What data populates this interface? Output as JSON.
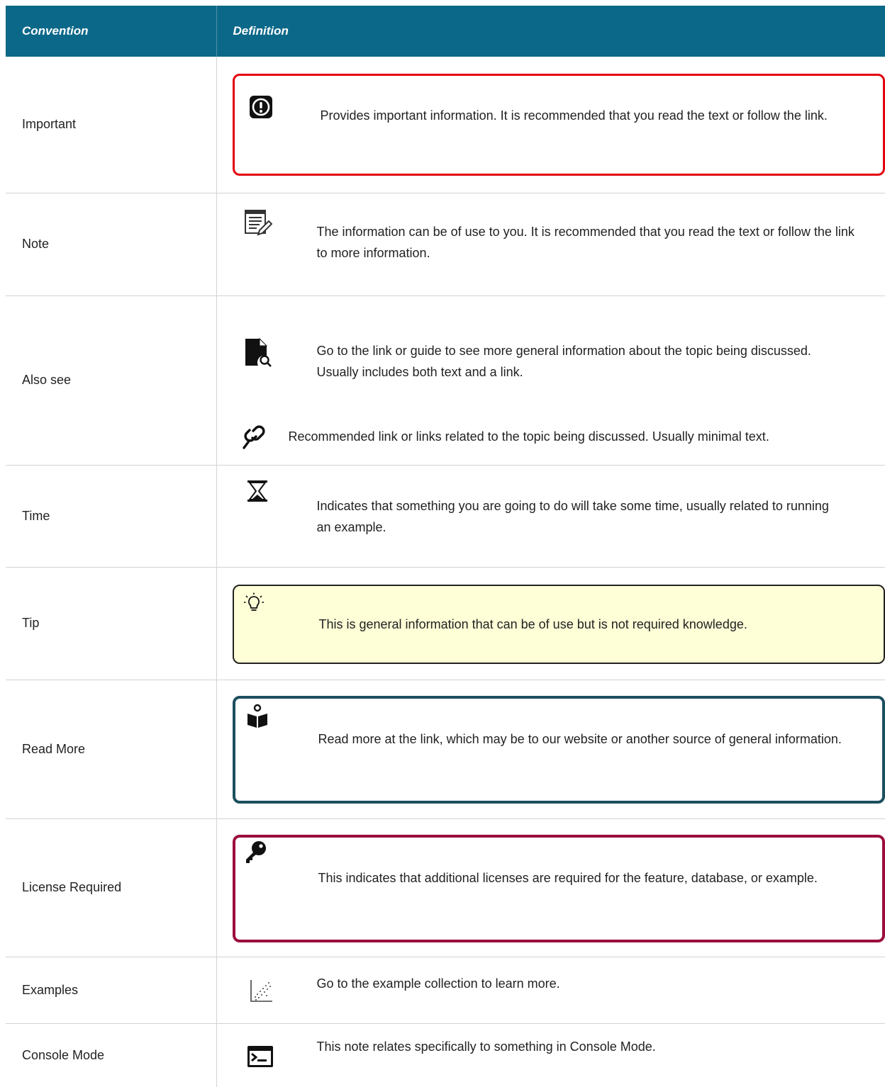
{
  "header": {
    "col1": "Convention",
    "col2": "Definition"
  },
  "rows": [
    {
      "label": "Important",
      "icon": "alert-circle-icon",
      "style": "red-outlined-box",
      "text": "Provides important information. It is recommended that you read the text or follow the link."
    },
    {
      "label": "Note",
      "icon": "note-pencil-icon",
      "text": "The information can be of use to you. It is recommended that you read the text or follow the link to more information."
    },
    {
      "label": "Also see",
      "icon": "document-search-icon",
      "text": "Go to the link or guide to see more general information about the topic being discussed. Usually includes both text and a link.",
      "icon2": "chain-link-icon",
      "text2": "Recommended link or links related to the topic being discussed. Usually minimal text."
    },
    {
      "label": "Time",
      "icon": "hourglass-icon",
      "text": "Indicates that something you are going to do will take some time, usually related to running an example."
    },
    {
      "label": "Tip",
      "icon": "lightbulb-icon",
      "style": "yellow-box",
      "text": "This is general information that can be of use but is not required knowledge."
    },
    {
      "label": "Read More",
      "icon": "book-reader-icon",
      "style": "dark-teal-outlined-box",
      "text": "Read more at the link, which may be to our website or another source of general information."
    },
    {
      "label": "License Required",
      "icon": "key-icon",
      "style": "maroon-outlined-box",
      "text": "This indicates that additional licenses are required for the feature, database, or example."
    },
    {
      "label": "Examples",
      "icon": "scatter-plot-icon",
      "text": "Go to the example collection to learn more."
    },
    {
      "label": "Console Mode",
      "icon": "terminal-icon",
      "text": "This note relates specifically to something in Console Mode."
    }
  ],
  "colors": {
    "header_bg": "#0c6889",
    "important_border": "#e3000f",
    "tip_bg": "#fefed7",
    "readmore_border": "#1c4f5f",
    "license_border": "#9b0d3f",
    "row_divider": "#d3d3d3"
  }
}
